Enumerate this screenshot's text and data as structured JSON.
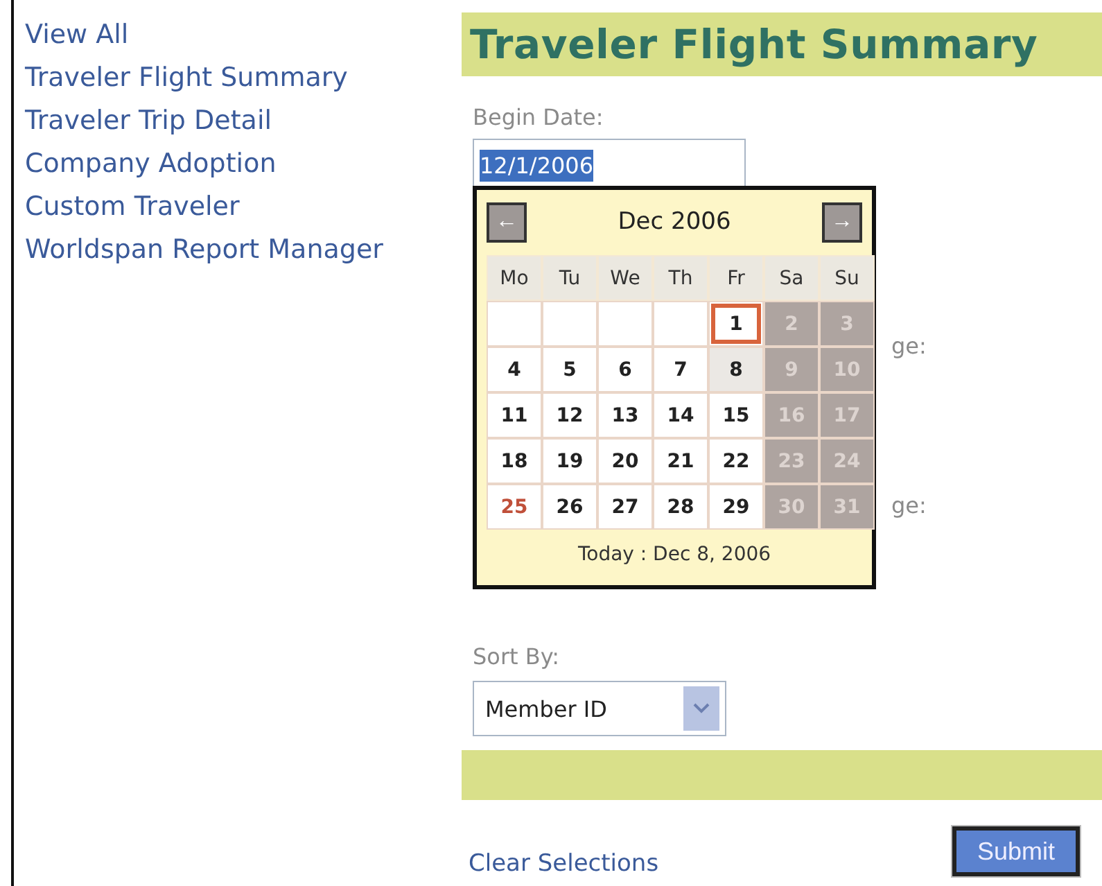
{
  "sidebar": {
    "items": [
      "View All",
      "Traveler Flight Summary",
      "Traveler Trip Detail",
      "Company Adoption",
      "Custom Traveler",
      "Worldspan Report Manager"
    ]
  },
  "title": "Traveler Flight Summary",
  "begin_date": {
    "label": "Begin Date:",
    "value": "12/1/2006"
  },
  "hidden_labels": [
    "ge:",
    "ge:"
  ],
  "calendar": {
    "prev": "←",
    "next": "→",
    "month": "Dec 2006",
    "weekdays": [
      "Mo",
      "Tu",
      "We",
      "Th",
      "Fr",
      "Sa",
      "Su"
    ],
    "days": [
      {
        "kind": "blank"
      },
      {
        "kind": "blank"
      },
      {
        "kind": "blank"
      },
      {
        "kind": "blank"
      },
      {
        "kind": "day",
        "day": "1",
        "selected": true,
        "weekend": false,
        "today": false,
        "holiday": false
      },
      {
        "kind": "day",
        "day": "2",
        "selected": false,
        "weekend": true,
        "today": false,
        "holiday": false
      },
      {
        "kind": "day",
        "day": "3",
        "selected": false,
        "weekend": true,
        "today": false,
        "holiday": false
      },
      {
        "kind": "day",
        "day": "4",
        "selected": false,
        "weekend": false,
        "today": false,
        "holiday": false
      },
      {
        "kind": "day",
        "day": "5",
        "selected": false,
        "weekend": false,
        "today": false,
        "holiday": false
      },
      {
        "kind": "day",
        "day": "6",
        "selected": false,
        "weekend": false,
        "today": false,
        "holiday": false
      },
      {
        "kind": "day",
        "day": "7",
        "selected": false,
        "weekend": false,
        "today": false,
        "holiday": false
      },
      {
        "kind": "day",
        "day": "8",
        "selected": false,
        "weekend": false,
        "today": true,
        "holiday": false
      },
      {
        "kind": "day",
        "day": "9",
        "selected": false,
        "weekend": true,
        "today": false,
        "holiday": false
      },
      {
        "kind": "day",
        "day": "10",
        "selected": false,
        "weekend": true,
        "today": false,
        "holiday": false
      },
      {
        "kind": "day",
        "day": "11",
        "selected": false,
        "weekend": false,
        "today": false,
        "holiday": false
      },
      {
        "kind": "day",
        "day": "12",
        "selected": false,
        "weekend": false,
        "today": false,
        "holiday": false
      },
      {
        "kind": "day",
        "day": "13",
        "selected": false,
        "weekend": false,
        "today": false,
        "holiday": false
      },
      {
        "kind": "day",
        "day": "14",
        "selected": false,
        "weekend": false,
        "today": false,
        "holiday": false
      },
      {
        "kind": "day",
        "day": "15",
        "selected": false,
        "weekend": false,
        "today": false,
        "holiday": false
      },
      {
        "kind": "day",
        "day": "16",
        "selected": false,
        "weekend": true,
        "today": false,
        "holiday": false
      },
      {
        "kind": "day",
        "day": "17",
        "selected": false,
        "weekend": true,
        "today": false,
        "holiday": false
      },
      {
        "kind": "day",
        "day": "18",
        "selected": false,
        "weekend": false,
        "today": false,
        "holiday": false
      },
      {
        "kind": "day",
        "day": "19",
        "selected": false,
        "weekend": false,
        "today": false,
        "holiday": false
      },
      {
        "kind": "day",
        "day": "20",
        "selected": false,
        "weekend": false,
        "today": false,
        "holiday": false
      },
      {
        "kind": "day",
        "day": "21",
        "selected": false,
        "weekend": false,
        "today": false,
        "holiday": false
      },
      {
        "kind": "day",
        "day": "22",
        "selected": false,
        "weekend": false,
        "today": false,
        "holiday": false
      },
      {
        "kind": "day",
        "day": "23",
        "selected": false,
        "weekend": true,
        "today": false,
        "holiday": false
      },
      {
        "kind": "day",
        "day": "24",
        "selected": false,
        "weekend": true,
        "today": false,
        "holiday": false
      },
      {
        "kind": "day",
        "day": "25",
        "selected": false,
        "weekend": false,
        "today": false,
        "holiday": true
      },
      {
        "kind": "day",
        "day": "26",
        "selected": false,
        "weekend": false,
        "today": false,
        "holiday": false
      },
      {
        "kind": "day",
        "day": "27",
        "selected": false,
        "weekend": false,
        "today": false,
        "holiday": false
      },
      {
        "kind": "day",
        "day": "28",
        "selected": false,
        "weekend": false,
        "today": false,
        "holiday": false
      },
      {
        "kind": "day",
        "day": "29",
        "selected": false,
        "weekend": false,
        "today": false,
        "holiday": false
      },
      {
        "kind": "day",
        "day": "30",
        "selected": false,
        "weekend": true,
        "today": false,
        "holiday": false
      },
      {
        "kind": "day",
        "day": "31",
        "selected": false,
        "weekend": true,
        "today": false,
        "holiday": false
      }
    ],
    "footer": "Today : Dec 8, 2006"
  },
  "sort_by": {
    "label": "Sort By:",
    "value": "Member ID"
  },
  "clear_link": "Clear Selections",
  "submit": "Submit"
}
